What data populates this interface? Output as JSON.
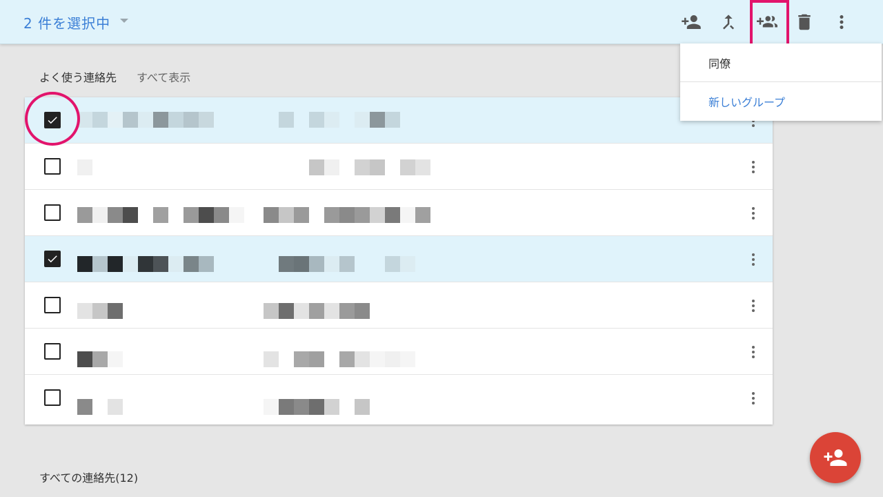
{
  "topbar": {
    "selection_title": "2 件を選択中",
    "icons": [
      "add-contact-icon",
      "merge-icon",
      "add-to-group-icon",
      "delete-icon",
      "more-vert-icon"
    ]
  },
  "frequent": {
    "label": "よく使う連絡先",
    "show_all": "すべて表示",
    "rows": [
      {
        "checked": true
      },
      {
        "checked": false
      },
      {
        "checked": false
      },
      {
        "checked": true
      },
      {
        "checked": false
      },
      {
        "checked": false
      },
      {
        "checked": false
      }
    ]
  },
  "all_contacts": {
    "label": "すべての連絡先(12)"
  },
  "group_menu": {
    "items": [
      "同僚",
      "新しいグループ"
    ]
  },
  "colors": {
    "accent": "#3b7fd6",
    "selected_row": "#e0f3fb",
    "annotation": "#e2146c",
    "fab": "#db4437"
  }
}
